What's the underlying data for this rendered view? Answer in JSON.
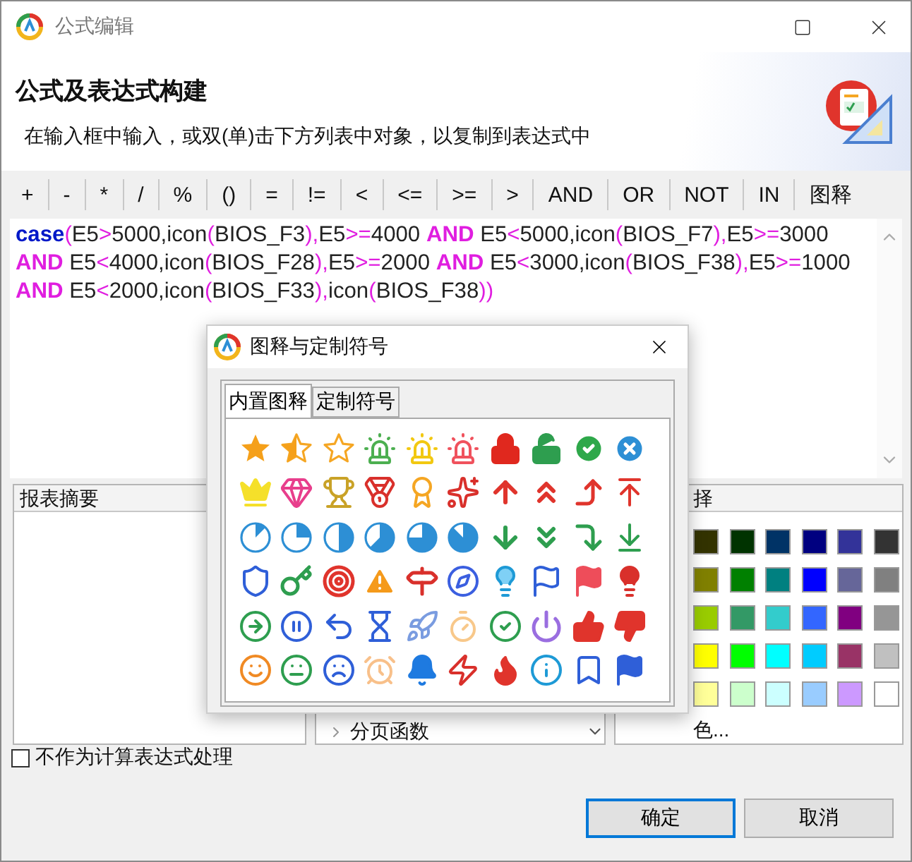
{
  "window": {
    "title": "公式编辑"
  },
  "header": {
    "heading": "公式及表达式构建",
    "subtitle": "在输入框中输入，或双(单)击下方列表中对象，以复制到表达式中"
  },
  "operators": [
    "+",
    "-",
    "*",
    "/",
    "%",
    "()",
    "=",
    "!=",
    "<",
    "<=",
    ">=",
    ">",
    "AND",
    "OR",
    "NOT",
    "IN",
    "图释"
  ],
  "expression": {
    "lines": [
      [
        {
          "text": "case",
          "kind": "keyword"
        },
        {
          "text": "(",
          "kind": "symbol"
        },
        {
          "text": "E5",
          "kind": "plain"
        },
        {
          "text": ">",
          "kind": "symbol"
        },
        {
          "text": "5000,icon",
          "kind": "plain"
        },
        {
          "text": "(",
          "kind": "symbol"
        },
        {
          "text": "BIOS_F3",
          "kind": "plain"
        },
        {
          "text": "),",
          "kind": "symbol"
        },
        {
          "text": "E5",
          "kind": "plain"
        },
        {
          "text": ">=",
          "kind": "symbol"
        },
        {
          "text": "4000 ",
          "kind": "plain"
        },
        {
          "text": "AND",
          "kind": "logic"
        },
        {
          "text": " E5",
          "kind": "plain"
        },
        {
          "text": "<",
          "kind": "symbol"
        },
        {
          "text": "5000,icon",
          "kind": "plain"
        },
        {
          "text": "(",
          "kind": "symbol"
        },
        {
          "text": "BIOS_F7",
          "kind": "plain"
        },
        {
          "text": "),",
          "kind": "symbol"
        },
        {
          "text": "E5",
          "kind": "plain"
        },
        {
          "text": ">=",
          "kind": "symbol"
        },
        {
          "text": "3000",
          "kind": "plain"
        }
      ],
      [
        {
          "text": "AND",
          "kind": "logic"
        },
        {
          "text": " E5",
          "kind": "plain"
        },
        {
          "text": "<",
          "kind": "symbol"
        },
        {
          "text": "4000,icon",
          "kind": "plain"
        },
        {
          "text": "(",
          "kind": "symbol"
        },
        {
          "text": "BIOS_F28",
          "kind": "plain"
        },
        {
          "text": "),",
          "kind": "symbol"
        },
        {
          "text": "E5",
          "kind": "plain"
        },
        {
          "text": ">=",
          "kind": "symbol"
        },
        {
          "text": "2000 ",
          "kind": "plain"
        },
        {
          "text": "AND",
          "kind": "logic"
        },
        {
          "text": " E5",
          "kind": "plain"
        },
        {
          "text": "<",
          "kind": "symbol"
        },
        {
          "text": "3000,icon",
          "kind": "plain"
        },
        {
          "text": "(",
          "kind": "symbol"
        },
        {
          "text": "BIOS_F38",
          "kind": "plain"
        },
        {
          "text": "),",
          "kind": "symbol"
        },
        {
          "text": "E5",
          "kind": "plain"
        },
        {
          "text": ">=",
          "kind": "symbol"
        },
        {
          "text": "1000",
          "kind": "plain"
        }
      ],
      [
        {
          "text": "AND",
          "kind": "logic"
        },
        {
          "text": " E5",
          "kind": "plain"
        },
        {
          "text": "<",
          "kind": "symbol"
        },
        {
          "text": "2000,icon",
          "kind": "plain"
        },
        {
          "text": "(",
          "kind": "symbol"
        },
        {
          "text": "BIOS_F33",
          "kind": "plain"
        },
        {
          "text": "),",
          "kind": "symbol"
        },
        {
          "text": "icon",
          "kind": "plain"
        },
        {
          "text": "(",
          "kind": "symbol"
        },
        {
          "text": "BIOS_F38",
          "kind": "plain"
        },
        {
          "text": "))",
          "kind": "symbol"
        }
      ]
    ]
  },
  "summary_panel": {
    "title": "报表摘要"
  },
  "function_panel": {
    "items": [
      {
        "label": "分页函数"
      }
    ]
  },
  "color_panel": {
    "title": "择",
    "more_label": "色...",
    "swatches": [
      {
        "color": "#333300"
      },
      {
        "color": "#003300"
      },
      {
        "color": "#003366"
      },
      {
        "color": "#000080"
      },
      {
        "color": "#333399"
      },
      {
        "color": "#333333"
      },
      {
        "color": "#808000"
      },
      {
        "color": "#008000"
      },
      {
        "color": "#008080"
      },
      {
        "color": "#0000ff"
      },
      {
        "color": "#666699"
      },
      {
        "color": "#808080"
      },
      {
        "color": "#99cc00"
      },
      {
        "color": "#339966"
      },
      {
        "color": "#33cccc"
      },
      {
        "color": "#3366ff"
      },
      {
        "color": "#800080"
      },
      {
        "color": "#969696"
      },
      {
        "color": "#ffff00"
      },
      {
        "color": "#00ff00"
      },
      {
        "color": "#00ffff"
      },
      {
        "color": "#00ccff"
      },
      {
        "color": "#993366"
      },
      {
        "color": "#c0c0c0"
      },
      {
        "color": "#ffff99"
      },
      {
        "color": "#ccffcc"
      },
      {
        "color": "#ccffff"
      },
      {
        "color": "#99ccff"
      },
      {
        "color": "#cc99ff"
      },
      {
        "color": "#ffffff"
      }
    ]
  },
  "checkbox": {
    "label": "不作为计算表达式处理",
    "checked": false
  },
  "buttons": [
    {
      "label": "确定",
      "default": true
    },
    {
      "label": "取消",
      "default": false
    }
  ],
  "popup": {
    "title": "图释与定制符号",
    "tabs": [
      {
        "label": "内置图释",
        "selected": true
      },
      {
        "label": "定制符号",
        "selected": false
      }
    ]
  }
}
